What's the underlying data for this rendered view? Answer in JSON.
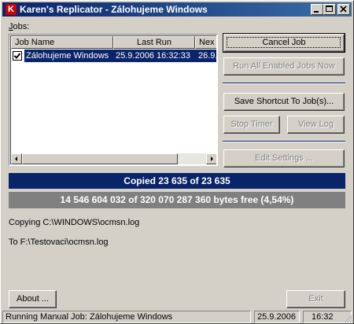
{
  "window": {
    "title": "Karen's Replicator - Zálohujeme Windows",
    "icon_letter": "K",
    "controls": [
      "minimize-icon",
      "maximize-icon",
      "close-icon"
    ]
  },
  "jobs_label": "Jobs:",
  "list": {
    "columns": [
      "Job Name",
      "Last Run",
      "Nex"
    ],
    "rows": [
      {
        "checked": true,
        "name": "Zálohujeme Windows",
        "last_run": "25.9.2006 16:32:33",
        "next": "26.9.20"
      }
    ]
  },
  "buttons": {
    "cancel_job": "Cancel Job",
    "run_all": "Run All Enabled Jobs Now",
    "save_shortcut": "Save Shortcut To Job(s)...",
    "stop_timer": "Stop Timer",
    "view_log": "View Log",
    "edit_settings": "Edit Settings ...",
    "about": "About ...",
    "exit": "Exit"
  },
  "progress": {
    "copied_text": "Copied 23 635 of 23 635",
    "copied_fraction": 1.0,
    "free_text": "14 546 604 032 of 320 070 287 360 bytes free (4,54%)",
    "accent_color": "#0a246a"
  },
  "copying": {
    "from": "Copying C:\\WINDOWS\\ocmsn.log",
    "to": "To F:\\Testovaci\\ocmsn.log"
  },
  "statusbar": {
    "message": "Running Manual Job: Zálohujeme Windows",
    "date": "25.9.2006",
    "time": "16:32"
  }
}
